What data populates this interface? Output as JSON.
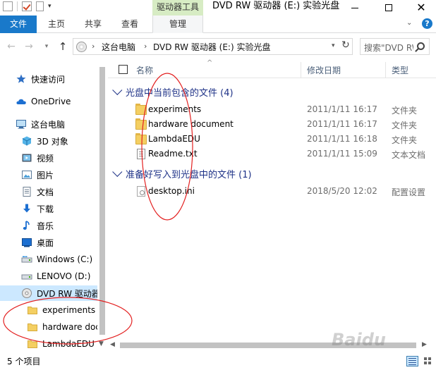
{
  "window": {
    "ctx_tab_title": "驱动器工具",
    "title": "DVD RW 驱动器 (E:) 实验光盘"
  },
  "ribbon": {
    "file": "文件",
    "home": "主页",
    "share": "共享",
    "view": "查看",
    "manage": "管理",
    "help": "?"
  },
  "address": {
    "crumbs": [
      "这台电脑",
      "DVD RW 驱动器 (E:) 实验光盘"
    ],
    "search_placeholder": "搜索\"DVD RW 驱动器 (E:) 实验光盘\""
  },
  "nav_pane": {
    "items": [
      {
        "label": "快速访问",
        "icon": "star-icon"
      },
      {
        "label": "OneDrive",
        "icon": "cloud-icon"
      },
      {
        "label": "这台电脑",
        "icon": "computer-icon"
      },
      {
        "label": "3D 对象",
        "icon": "cube-icon"
      },
      {
        "label": "视频",
        "icon": "video-icon"
      },
      {
        "label": "图片",
        "icon": "picture-icon"
      },
      {
        "label": "文档",
        "icon": "document-icon"
      },
      {
        "label": "下载",
        "icon": "download-icon"
      },
      {
        "label": "音乐",
        "icon": "music-icon"
      },
      {
        "label": "桌面",
        "icon": "desktop-icon"
      },
      {
        "label": "Windows (C:)",
        "icon": "drive-icon"
      },
      {
        "label": "LENOVO (D:)",
        "icon": "drive-icon"
      },
      {
        "label": "DVD RW 驱动器 (E:) 实验光盘",
        "icon": "disc-icon"
      },
      {
        "label": "experiments",
        "icon": "folder-icon"
      },
      {
        "label": "hardware document",
        "icon": "folder-icon"
      },
      {
        "label": "LambdaEDU",
        "icon": "folder-icon"
      }
    ]
  },
  "columns": {
    "name": "名称",
    "date": "修改日期",
    "type": "类型"
  },
  "groups": [
    {
      "title": "光盘中当前包含的文件 (4)",
      "rows": [
        {
          "name": "experiments",
          "date": "2011/1/11 16:17",
          "type": "文件夹",
          "icon": "folder-icon"
        },
        {
          "name": "hardware document",
          "date": "2011/1/11 16:17",
          "type": "文件夹",
          "icon": "folder-icon"
        },
        {
          "name": "LambdaEDU",
          "date": "2011/1/11 16:18",
          "type": "文件夹",
          "icon": "folder-icon"
        },
        {
          "name": "Readme.txt",
          "date": "2011/1/11 15:09",
          "type": "文本文档",
          "icon": "text-file-icon"
        }
      ]
    },
    {
      "title": "准备好写入到光盘中的文件 (1)",
      "rows": [
        {
          "name": "desktop.ini",
          "date": "2018/5/20 12:02",
          "type": "配置设置",
          "icon": "ini-file-icon"
        }
      ]
    }
  ],
  "status": {
    "count": "5 个项目"
  },
  "watermark": "Baidu",
  "colors": {
    "accent": "#1979ca",
    "context_tab": "#d7ecc4",
    "group_title": "#1e3287",
    "selection": "#cce8ff",
    "annotation": "#e32020"
  }
}
